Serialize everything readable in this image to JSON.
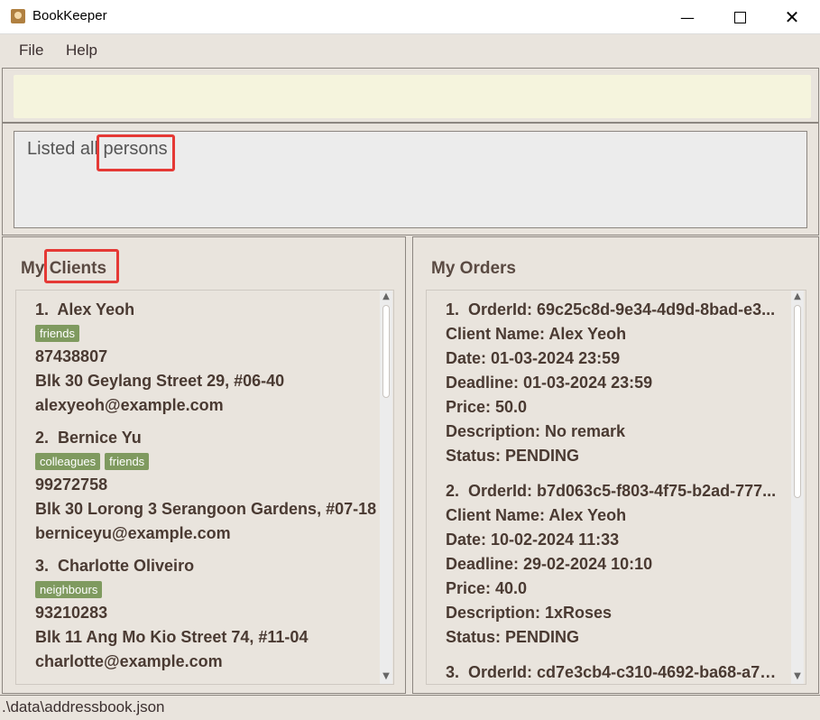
{
  "window": {
    "title": "BookKeeper",
    "minimize_icon": "minimize-icon",
    "maximize_icon": "maximize-icon",
    "close_icon": "close-icon"
  },
  "menu": {
    "file": "File",
    "help": "Help"
  },
  "command": {
    "value": "",
    "placeholder": ""
  },
  "result": {
    "prefix": "Listed all ",
    "highlighted": "persons"
  },
  "clients": {
    "title_prefix": "My ",
    "title_highlight": "Clients",
    "items": [
      {
        "index": "1.",
        "name": "Alex Yeoh",
        "tags": [
          "friends"
        ],
        "phone": "87438807",
        "address": "Blk 30 Geylang Street 29, #06-40",
        "email": "alexyeoh@example.com"
      },
      {
        "index": "2.",
        "name": "Bernice Yu",
        "tags": [
          "colleagues",
          "friends"
        ],
        "phone": "99272758",
        "address": "Blk 30 Lorong 3 Serangoon Gardens, #07-18",
        "email": "berniceyu@example.com"
      },
      {
        "index": "3.",
        "name": "Charlotte Oliveiro",
        "tags": [
          "neighbours"
        ],
        "phone": "93210283",
        "address": "Blk 11 Ang Mo Kio Street 74, #11-04",
        "email": "charlotte@example.com"
      }
    ]
  },
  "orders": {
    "title": "My Orders",
    "items": [
      {
        "index": "1.",
        "id": "OrderId: 69c25c8d-9e34-4d9d-8bad-e3...",
        "client": "Client Name: Alex Yeoh",
        "date": "Date: 01-03-2024 23:59",
        "deadline": "Deadline: 01-03-2024 23:59",
        "price": "Price: 50.0",
        "description": "Description: No remark",
        "status": "Status: PENDING"
      },
      {
        "index": "2.",
        "id": "OrderId: b7d063c5-f803-4f75-b2ad-777...",
        "client": "Client Name: Alex Yeoh",
        "date": "Date: 10-02-2024 11:33",
        "deadline": "Deadline: 29-02-2024 10:10",
        "price": "Price: 40.0",
        "description": "Description: 1xRoses",
        "status": "Status: PENDING"
      },
      {
        "index": "3.",
        "id": "OrderId: cd7e3cb4-c310-4692-ba68-a77..."
      }
    ]
  },
  "status": {
    "path": ".\\data\\addressbook.json"
  },
  "colors": {
    "tag": "#7f9a5f",
    "highlight": "#e53935",
    "command_bg": "#f5f4dd"
  }
}
